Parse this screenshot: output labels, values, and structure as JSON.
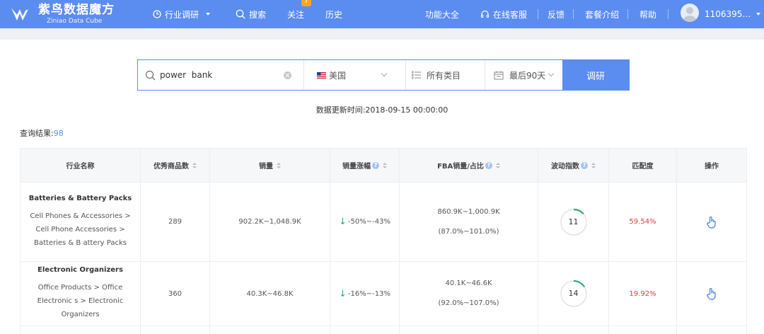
{
  "brand": {
    "name_cn": "紫鸟数据魔方",
    "name_en": "Ziniao Data Cube"
  },
  "nav": {
    "industry_research": "行业调研",
    "search": "搜索",
    "follow": "关注",
    "follow_badge": "7",
    "history": "历史",
    "all_features": "功能大全",
    "online_service": "在线客服",
    "feedback": "反馈",
    "plans": "套餐介绍",
    "help": "帮助",
    "user": "1106395…"
  },
  "search": {
    "query": "power  bank",
    "placeholder": "",
    "country": "美国",
    "category": "所有类目",
    "period": "最后90天",
    "submit": "调研"
  },
  "update_time": "数据更新时间:2018-09-15 00:00:00",
  "results": {
    "label": "查询结果:",
    "count": "98"
  },
  "table": {
    "headers": {
      "industry": "行业名称",
      "good_products": "优秀商品数",
      "sales": "销量",
      "sales_change": "销量涨幅",
      "fba": "FBA销量/占比",
      "volatility": "波动指数",
      "match": "匹配度",
      "action": "操作"
    },
    "rows": [
      {
        "name": "Batteries & Battery Packs",
        "path": "Cell Phones & Accessories > Cell Phone Accessories > Batteries & B attery Packs",
        "good_products": "289",
        "sales": "902.2K~1,048.9K",
        "sales_change": "-50%~-43%",
        "fba_sales": "860.9K~1,000.9K",
        "fba_ratio": "(87.0%~101.0%)",
        "volatility": "11",
        "match": "59.54%"
      },
      {
        "name": "Electronic Organizers",
        "path": "Office Products > Office Electronic s > Electronic Organizers",
        "good_products": "360",
        "sales": "40.3K~46.8K",
        "sales_change": "-16%~-13%",
        "fba_sales": "40.1K~46.6K",
        "fba_ratio": "(92.0%~107.0%)",
        "volatility": "14",
        "match": "19.92%"
      }
    ]
  },
  "colors": {
    "primary": "#5b8cf0",
    "match_red": "#e23a3a",
    "down_green": "#2cae6e",
    "gauge_green": "#2cae6e"
  },
  "icons": {
    "logo": "bird-logo-icon",
    "clock": "clock-icon",
    "search": "search-icon",
    "service": "headset-icon",
    "list": "list-icon",
    "calendar": "calendar-icon",
    "action": "hand-pointer-icon"
  }
}
